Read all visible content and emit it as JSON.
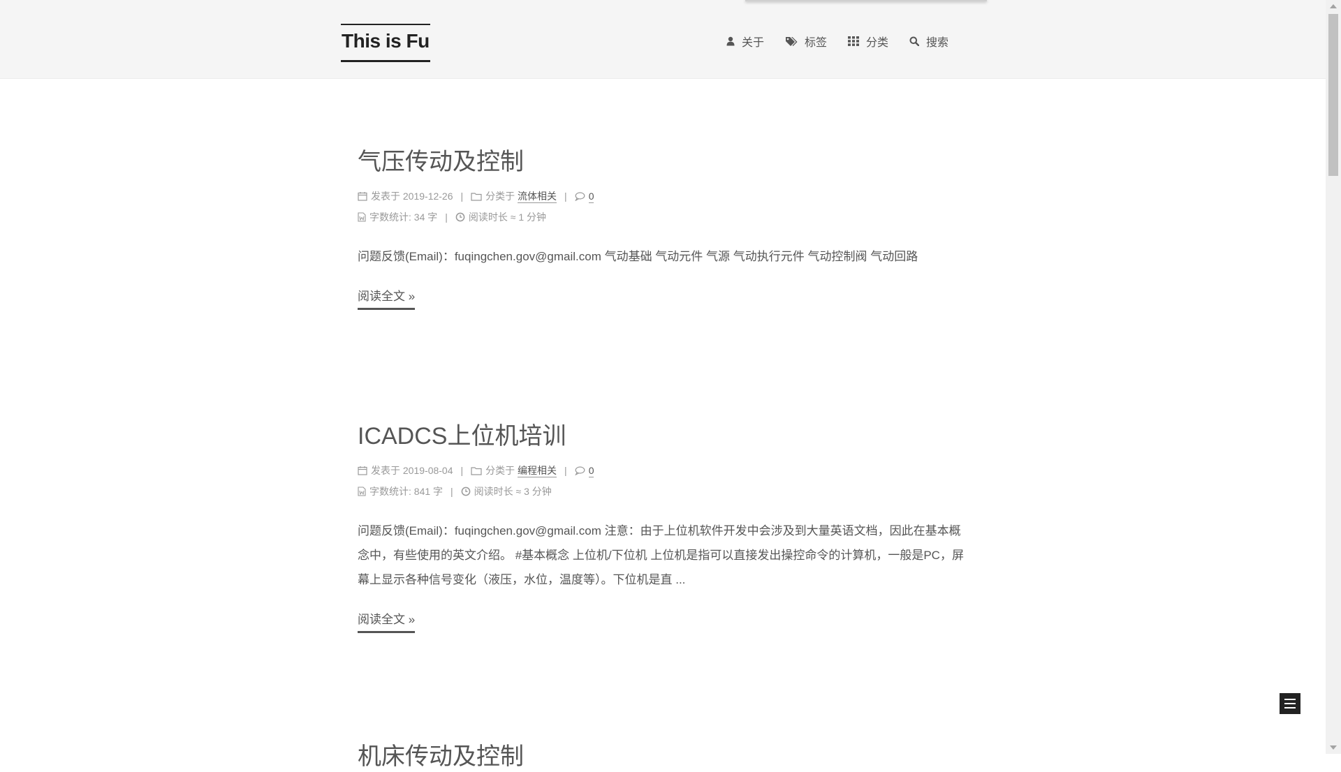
{
  "site": {
    "title": "This is Fu"
  },
  "nav": {
    "items": [
      {
        "label": "关于",
        "icon": "user-icon"
      },
      {
        "label": "标签",
        "icon": "tags-icon"
      },
      {
        "label": "分类",
        "icon": "th-icon"
      },
      {
        "label": "搜索",
        "icon": "search-icon"
      }
    ]
  },
  "posts": [
    {
      "title": "气压传动及控制",
      "posted_label": "发表于",
      "date": "2019-12-26",
      "category_label": "分类于",
      "category": "流体相关",
      "comments": "0",
      "wordcount_label": "字数统计: 34 字",
      "readtime_label": "阅读时长 ≈ 1 分钟",
      "excerpt": "问题反馈(Email)：fuqingchen.gov@gmail.com 气动基础 气动元件 气源 气动执行元件 气动控制阀 气动回路",
      "read_more": "阅读全文 »"
    },
    {
      "title": "ICADCS上位机培训",
      "posted_label": "发表于",
      "date": "2019-08-04",
      "category_label": "分类于",
      "category": "编程相关",
      "comments": "0",
      "wordcount_label": "字数统计: 841 字",
      "readtime_label": "阅读时长 ≈ 3 分钟",
      "excerpt": "问题反馈(Email)：fuqingchen.gov@gmail.com 注意：由于上位机软件开发中会涉及到大量英语文档，因此在基本概念中，有些使用的英文介绍。 #基本概念 上位机/下位机 上位机是指可以直接发出操控命令的计算机，一般是PC，屏幕上显示各种信号变化（液压，水位，温度等）。下位机是直 ...",
      "read_more": "阅读全文 »"
    },
    {
      "title": "机床传动及控制"
    }
  ],
  "colors": {
    "header_bg": "#f5f5f5",
    "text": "#555555",
    "meta": "#999999",
    "logo": "#222222"
  }
}
